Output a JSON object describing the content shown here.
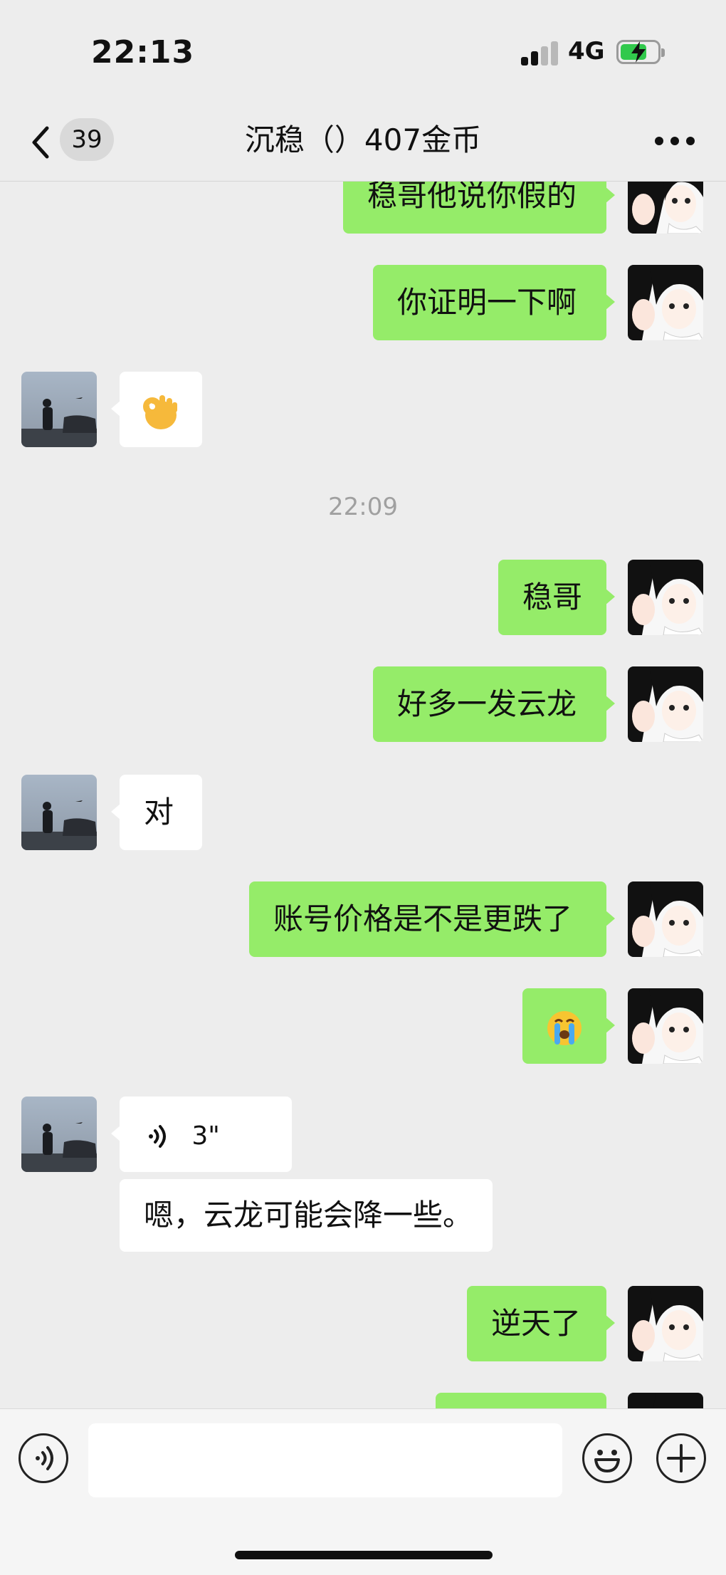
{
  "status_bar": {
    "time": "22:13",
    "network": "4G"
  },
  "nav": {
    "unread_count": "39",
    "title": "沉稳（）407金币"
  },
  "messages": {
    "m1": "稳哥他说你假的",
    "m2": "你证明一下啊",
    "m3_sticker": "ok-hand-emoji",
    "timestamp": "22:09",
    "m4": "稳哥",
    "m5": "好多一发云龙",
    "m6": "对",
    "m7": "账号价格是不是更跌了",
    "m8_sticker": "crying-emoji",
    "m9_voice_duration": "3\"",
    "m10": "嗯，云龙可能会降一些。",
    "m11": "逆天了"
  },
  "input": {
    "placeholder": ""
  },
  "colors": {
    "background": "#ededed",
    "my_bubble": "#95ec69",
    "other_bubble": "#ffffff",
    "battery": "#31c94c"
  }
}
